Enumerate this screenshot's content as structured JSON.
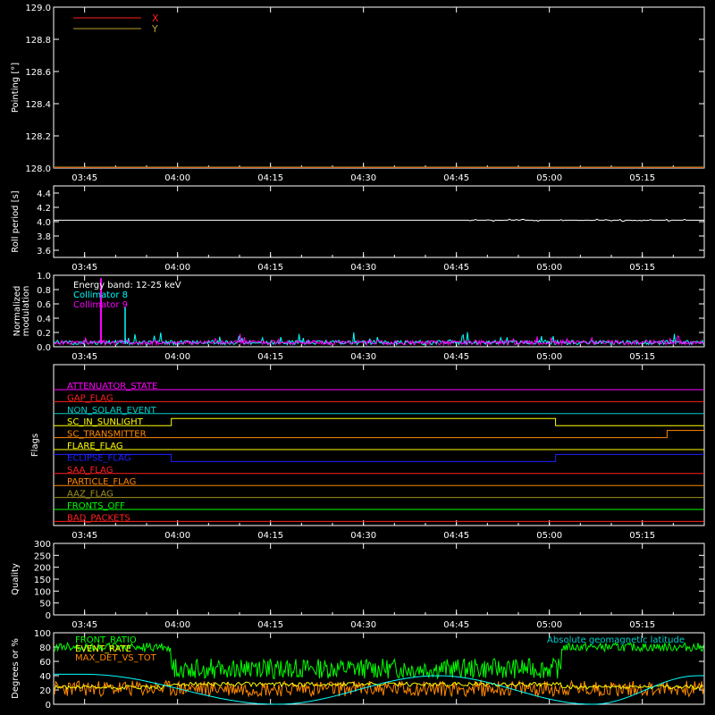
{
  "time_ticks": [
    "03:45",
    "04:00",
    "04:15",
    "04:30",
    "04:45",
    "05:00",
    "05:15"
  ],
  "colors": {
    "axis": "#ffffff",
    "pointing_x": "#ff2020",
    "pointing_y": "#b8a030",
    "cyan": "#00ffff",
    "magenta": "#ff00ff",
    "green": "#00ff00",
    "orange": "#ff8800",
    "yellow": "#ffff00"
  },
  "chart_data": [
    {
      "type": "line",
      "id": "pointing",
      "ylabel": "Pointing [°]",
      "ylim": [
        128.0,
        129.0
      ],
      "yticks": [
        "129.0",
        "128.8",
        "128.6",
        "128.4",
        "128.2",
        "128.0"
      ],
      "yticks_values": [
        129.0,
        128.8,
        128.6,
        128.4,
        128.2,
        128.0
      ],
      "legend": [
        {
          "name": "X",
          "color": "#ff2020"
        },
        {
          "name": "Y",
          "color": "#b8a030"
        }
      ],
      "series": [
        {
          "name": "X",
          "values": [
            128.0,
            128.0
          ]
        },
        {
          "name": "Y",
          "values": [
            128.0,
            128.0
          ]
        }
      ]
    },
    {
      "type": "line",
      "id": "roll",
      "ylabel": "Roll period [s]",
      "ylim": [
        3.5,
        4.5
      ],
      "yticks": [
        "4.4",
        "4.2",
        "4.0",
        "3.8",
        "3.6"
      ],
      "yticks_values": [
        4.4,
        4.2,
        4.0,
        3.8,
        3.6
      ],
      "series": [
        {
          "name": "roll",
          "values": [
            4.02,
            4.02
          ]
        }
      ]
    },
    {
      "type": "line",
      "id": "modulation",
      "ylabel": "Normalized modulation",
      "ylabel_lines": [
        "Normalized",
        "modulation"
      ],
      "ylim": [
        0.0,
        1.0
      ],
      "yticks": [
        "1.0",
        "0.8",
        "0.6",
        "0.4",
        "0.2",
        "0.0"
      ],
      "yticks_values": [
        1.0,
        0.8,
        0.6,
        0.4,
        0.2,
        0.0
      ],
      "annotations": [
        {
          "text": "Energy band: 12-25 keV",
          "color": "#ffffff"
        },
        {
          "text": "Collimator 8",
          "color": "#00ffff"
        },
        {
          "text": "Collimator 9",
          "color": "#ff00ff"
        }
      ],
      "series": [
        {
          "name": "Collimator 8",
          "baseline": 0.06
        },
        {
          "name": "Collimator 9",
          "baseline": 0.06
        }
      ]
    },
    {
      "type": "line",
      "id": "flags",
      "ylabel": "Flags",
      "flags": [
        {
          "name": "ATTENUATOR_STATE",
          "color": "#ff00ff"
        },
        {
          "name": "GAP_FLAG",
          "color": "#ff2020"
        },
        {
          "name": "NON_SOLAR_EVENT",
          "color": "#00cccc"
        },
        {
          "name": "SC_IN_SUNLIGHT",
          "color": "#ffff00"
        },
        {
          "name": "SC_TRANSMITTER",
          "color": "#ff8800"
        },
        {
          "name": "FLARE_FLAG",
          "color": "#ffff00"
        },
        {
          "name": "ECLIPSE_FLAG",
          "color": "#2020ff"
        },
        {
          "name": "SAA_FLAG",
          "color": "#ff2020"
        },
        {
          "name": "PARTICLE_FLAG",
          "color": "#ff8800"
        },
        {
          "name": "AAZ_FLAG",
          "color": "#a09020"
        },
        {
          "name": "FRONTS_OFF",
          "color": "#00ff00"
        },
        {
          "name": "BAD_PACKETS",
          "color": "#ff2020"
        }
      ],
      "steps": {
        "SC_IN_SUNLIGHT": [
          {
            "from": "03:45",
            "to": "03:59",
            "state": 0
          },
          {
            "from": "03:59",
            "to": "05:01",
            "state": 1
          },
          {
            "from": "05:01",
            "to": "05:24",
            "state": 0
          }
        ],
        "ECLIPSE_FLAG": [
          {
            "from": "03:45",
            "to": "03:59",
            "state": 1
          },
          {
            "from": "03:59",
            "to": "05:01",
            "state": 0
          },
          {
            "from": "05:01",
            "to": "05:24",
            "state": 1
          }
        ],
        "SC_TRANSMITTER": [
          {
            "from": "03:45",
            "to": "05:19",
            "state": 0
          },
          {
            "from": "05:19",
            "to": "05:24",
            "state": 1
          }
        ]
      }
    },
    {
      "type": "line",
      "id": "quality",
      "ylabel": "Quality",
      "ylim": [
        0,
        300
      ],
      "yticks": [
        "300",
        "250",
        "200",
        "150",
        "100",
        "50",
        "0"
      ],
      "yticks_values": [
        300,
        250,
        200,
        150,
        100,
        50,
        0
      ],
      "series": []
    },
    {
      "type": "line",
      "id": "degrees",
      "ylabel": "Degrees or %",
      "ylim": [
        0,
        100
      ],
      "yticks": [
        "100",
        "80",
        "60",
        "40",
        "20",
        "0"
      ],
      "yticks_values": [
        100,
        80,
        60,
        40,
        20,
        0
      ],
      "legend": [
        {
          "name": "FRONT_RATIO",
          "color": "#00ff00"
        },
        {
          "name": "EVENT_RATE",
          "color": "#ffff00"
        },
        {
          "name": "MAX_DET_VS_TOT",
          "color": "#ff8800"
        },
        {
          "name": "Absolute geomagnetic latitude",
          "color": "#00cccc"
        }
      ],
      "series": [
        {
          "name": "FRONT_RATIO",
          "segments": [
            {
              "from": "03:45",
              "to": "03:59",
              "mean": 80
            },
            {
              "from": "03:59",
              "to": "05:02",
              "mean": 50
            },
            {
              "from": "05:02",
              "to": "05:24",
              "mean": 80
            }
          ]
        },
        {
          "name": "MAX_DET_VS_TOT",
          "mean": 22
        },
        {
          "name": "EVENT_RATE",
          "mean": 28
        },
        {
          "name": "Absolute geomagnetic latitude",
          "peaks": [
            {
              "t": "03:45",
              "v": 42
            },
            {
              "t": "04:16",
              "v": 0
            },
            {
              "t": "04:42",
              "v": 40
            },
            {
              "t": "05:07",
              "v": 0
            },
            {
              "t": "05:24",
              "v": 40
            }
          ]
        }
      ]
    }
  ]
}
